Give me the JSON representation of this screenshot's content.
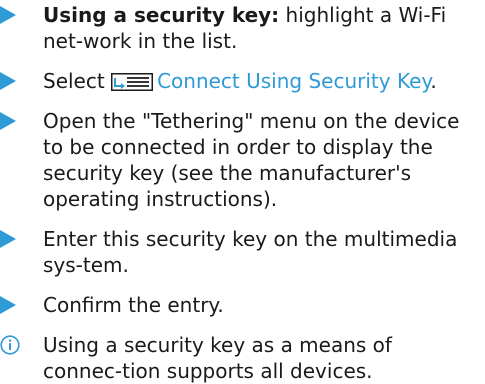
{
  "steps": [
    {
      "bold": "Using a security key:",
      "text": " highlight a Wi-Fi net-work in the list."
    },
    {
      "prefix": "Select ",
      "icon": "menu-list-icon",
      "link": "Connect Using Security Key",
      "suffix": "."
    },
    {
      "text": "Open the \"Tethering\" menu on the device to be connected in order to display the security key (see the manufacturer's operating instructions)."
    },
    {
      "text": "Enter this security key on the multimedia sys-tem."
    },
    {
      "text": "Confirm the entry."
    }
  ],
  "note": {
    "icon": "info-icon",
    "text": "Using a security key as a means of connec-tion supports all devices."
  },
  "colors": {
    "accent": "#2e9ad6",
    "text": "#1a1a1a"
  }
}
